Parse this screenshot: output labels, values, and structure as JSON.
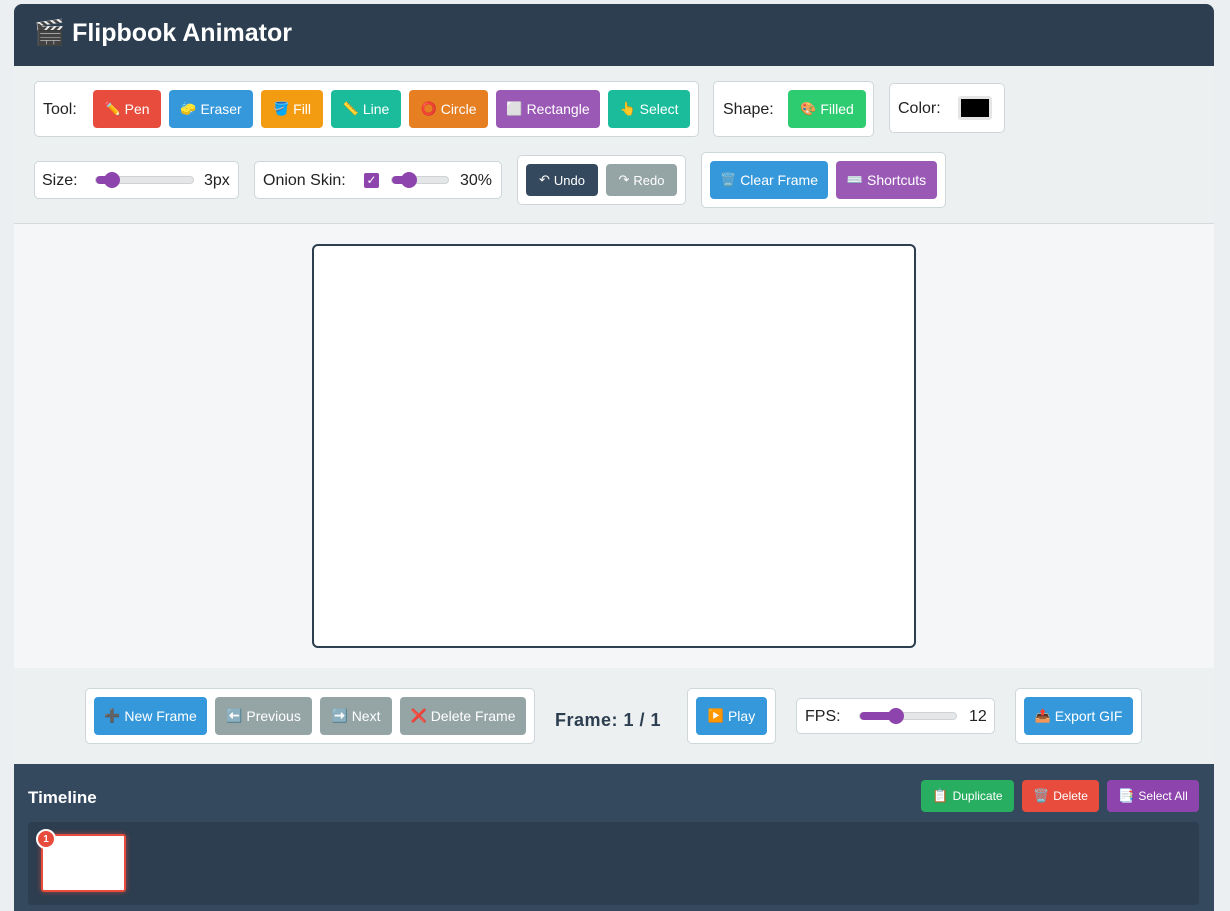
{
  "app": {
    "title": "🎬 Flipbook Animator"
  },
  "colors": {
    "header_bg": "#2c3e50",
    "pen": "#e74c3c",
    "eraser": "#3498db",
    "fill": "#f39c12",
    "line": "#1abc9c",
    "circle": "#e67e22",
    "rectangle": "#9b59b6",
    "select": "#1abc9c",
    "filled": "#2ecc71",
    "undo": "#34495e",
    "redo": "#95a5a6",
    "clear": "#3498db",
    "shortcuts": "#9b59b6",
    "new_frame": "#3498db",
    "nav_disabled": "#95a5a6",
    "play": "#3498db",
    "export": "#3498db",
    "duplicate": "#27ae60",
    "delete": "#e74c3c",
    "select_all": "#8e44ad",
    "slider_accent": "#8e44ad",
    "current_color": "#000000"
  },
  "toolbar": {
    "tool_label": "Tool:",
    "tools": [
      {
        "icon": "pencil-icon",
        "glyph": "✏️",
        "label": "Pen"
      },
      {
        "icon": "sponge-icon",
        "glyph": "🧽",
        "label": "Eraser"
      },
      {
        "icon": "bucket-icon",
        "glyph": "🪣",
        "label": "Fill"
      },
      {
        "icon": "ruler-icon",
        "glyph": "📏",
        "label": "Line"
      },
      {
        "icon": "circle-icon",
        "glyph": "⭕",
        "label": "Circle"
      },
      {
        "icon": "square-icon",
        "glyph": "⬜",
        "label": "Rectangle"
      },
      {
        "icon": "pointer-icon",
        "glyph": "👆",
        "label": "Select"
      }
    ],
    "shape_label": "Shape:",
    "shape_button": {
      "icon": "palette-icon",
      "glyph": "🎨",
      "label": "Filled"
    },
    "color_label": "Color:",
    "size_label": "Size:",
    "size_value": "3px",
    "size_fraction": 0.16,
    "onion_label": "Onion Skin:",
    "onion_checked": true,
    "onion_value": "30%",
    "onion_fraction": 0.3,
    "undo": {
      "glyph": "↶",
      "label": "Undo"
    },
    "redo": {
      "glyph": "↷",
      "label": "Redo"
    },
    "clear": {
      "icon": "trash-icon",
      "glyph": "🗑️",
      "label": "Clear Frame"
    },
    "shortcuts": {
      "icon": "keyboard-icon",
      "glyph": "⌨️",
      "label": "Shortcuts"
    }
  },
  "controls": {
    "new_frame": {
      "glyph": "➕",
      "label": "New Frame"
    },
    "previous": {
      "glyph": "⬅️",
      "label": "Previous"
    },
    "next": {
      "glyph": "➡️",
      "label": "Next"
    },
    "delete_frame": {
      "glyph": "❌",
      "label": "Delete Frame"
    },
    "frame_indicator": "Frame: 1 / 1",
    "play": {
      "glyph": "▶️",
      "label": "Play"
    },
    "fps_label": "FPS:",
    "fps_value": "12",
    "fps_fraction": 0.38,
    "export": {
      "glyph": "📤",
      "label": "Export GIF"
    }
  },
  "timeline": {
    "title": "Timeline",
    "duplicate": {
      "glyph": "📋",
      "label": "Duplicate"
    },
    "delete": {
      "glyph": "🗑️",
      "label": "Delete"
    },
    "select_all": {
      "glyph": "📑",
      "label": "Select All"
    },
    "frames": [
      {
        "number": "1"
      }
    ]
  }
}
